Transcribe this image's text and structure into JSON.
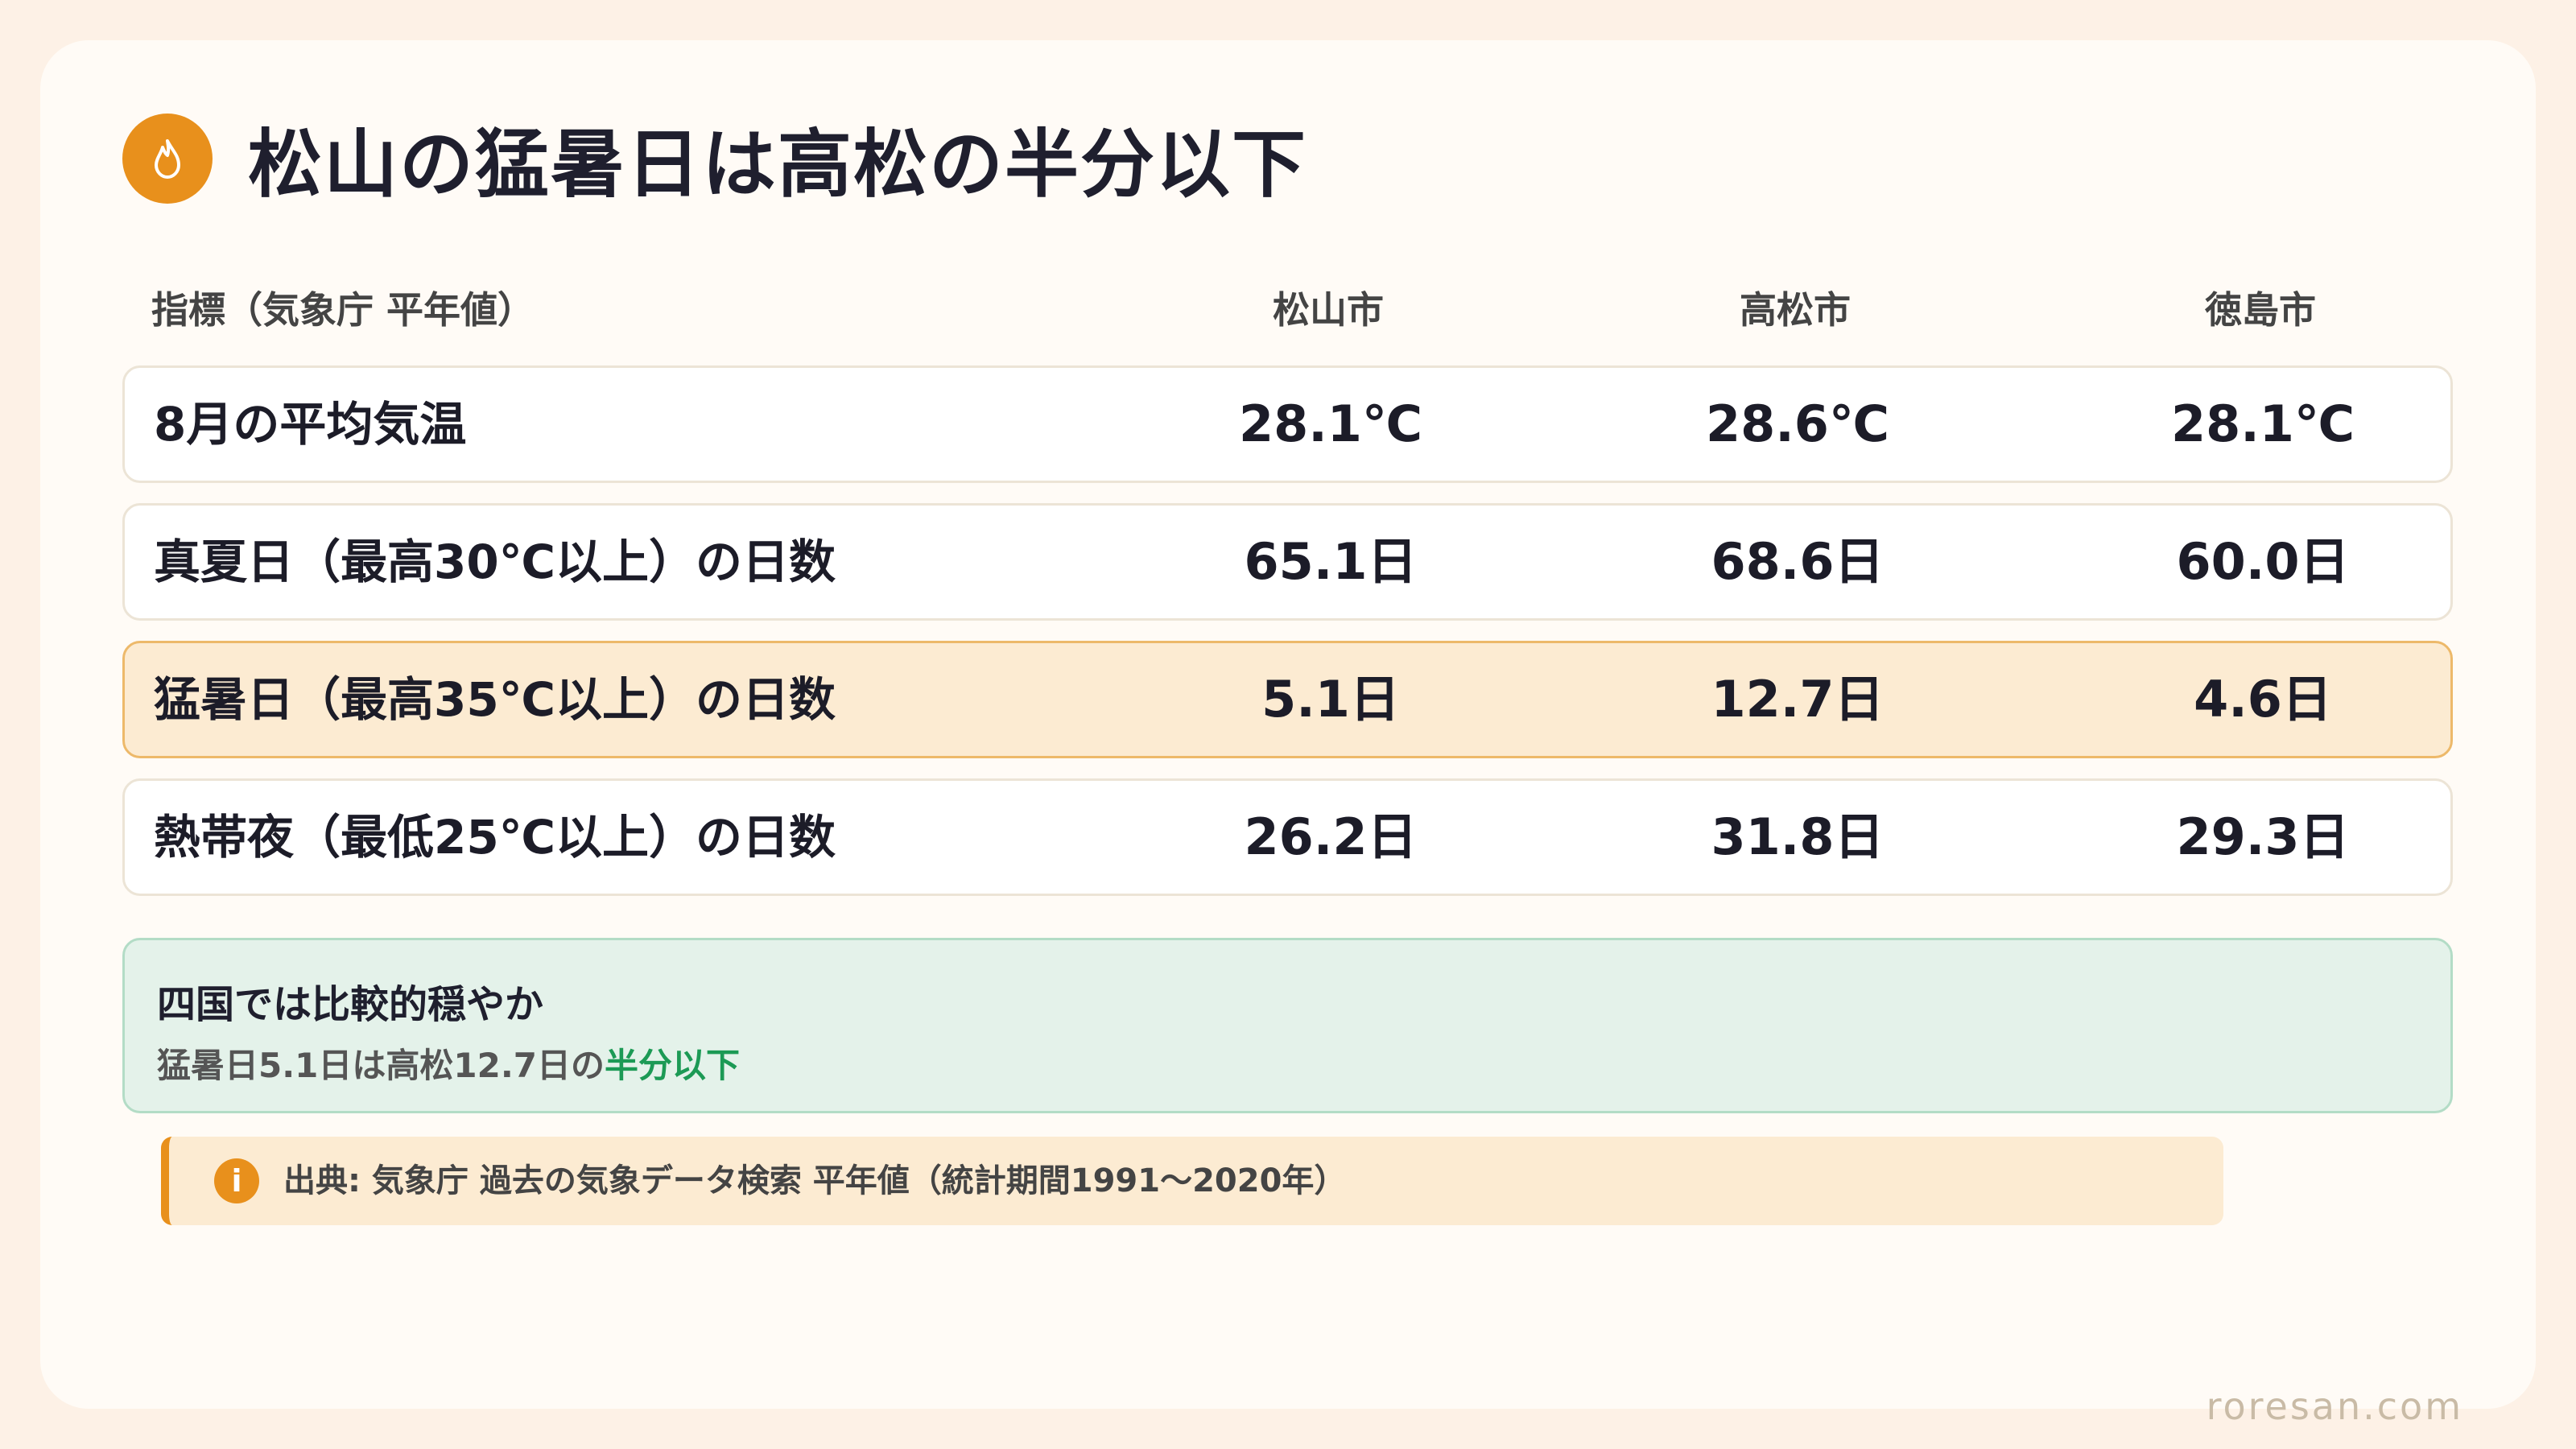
{
  "title": "松山の猛暑日は高松の半分以下",
  "title_icon": "flame-icon",
  "table": {
    "header_label": "指標（気象庁 平年値）",
    "columns": [
      "松山市",
      "高松市",
      "徳島市"
    ],
    "rows": [
      {
        "label": "8月の平均気温",
        "values": [
          "28.1℃",
          "28.6℃",
          "28.1℃"
        ],
        "highlight": false
      },
      {
        "label": "真夏日（最高30℃以上）の日数",
        "values": [
          "65.1日",
          "68.6日",
          "60.0日"
        ],
        "highlight": false
      },
      {
        "label": "猛暑日（最高35℃以上）の日数",
        "values": [
          "5.1日",
          "12.7日",
          "4.6日"
        ],
        "highlight": true
      },
      {
        "label": "熱帯夜（最低25℃以上）の日数",
        "values": [
          "26.2日",
          "31.8日",
          "29.3日"
        ],
        "highlight": false
      }
    ]
  },
  "summary": {
    "title": "四国では比較的穏やか",
    "text": "猛暑日5.1日は高松12.7日の",
    "accent": "半分以下"
  },
  "source": {
    "icon": "info-icon",
    "icon_glyph": "i",
    "text": "出典: 気象庁 過去の気象データ検索 平年値（統計期間1991〜2020年）"
  },
  "brand": "roresan.com",
  "colors": {
    "accent_orange": "#e8901c",
    "highlight_bg": "#fcebd2",
    "summary_bg": "#e4f2ea",
    "summary_accent": "#1c9a55"
  }
}
